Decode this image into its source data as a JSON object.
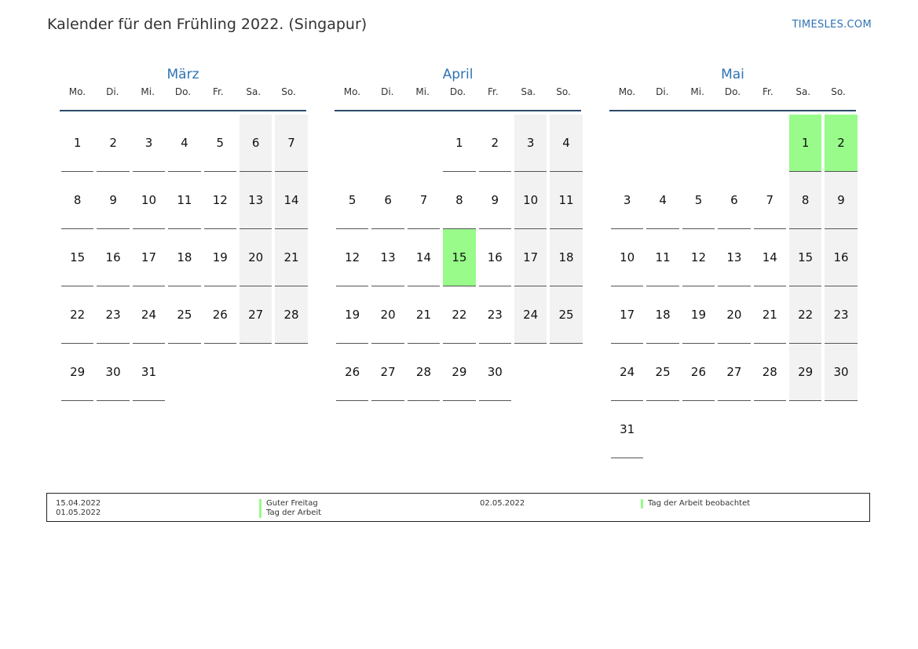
{
  "title": "Kalender für den Frühling 2022. (Singapur)",
  "site": "TIMESLES.COM",
  "colors": {
    "accent": "#2f73b5",
    "weekend": "#f2f2f2",
    "holiday": "#98fb8a"
  },
  "weekdays": [
    "Mo.",
    "Di.",
    "Mi.",
    "Do.",
    "Fr.",
    "Sa.",
    "So."
  ],
  "months": [
    {
      "name": "März",
      "first_weekday": 1,
      "days": 31,
      "holidays": []
    },
    {
      "name": "April",
      "first_weekday": 4,
      "days": 30,
      "holidays": [
        15
      ]
    },
    {
      "name": "Mai",
      "first_weekday": 6,
      "days": 31,
      "holidays": [
        1,
        2
      ]
    }
  ],
  "legend": [
    {
      "date": "15.04.2022",
      "name": "Guter Freitag"
    },
    {
      "date": "01.05.2022",
      "name": "Tag der Arbeit"
    },
    {
      "date": "02.05.2022",
      "name": "Tag der Arbeit beobachtet"
    }
  ]
}
